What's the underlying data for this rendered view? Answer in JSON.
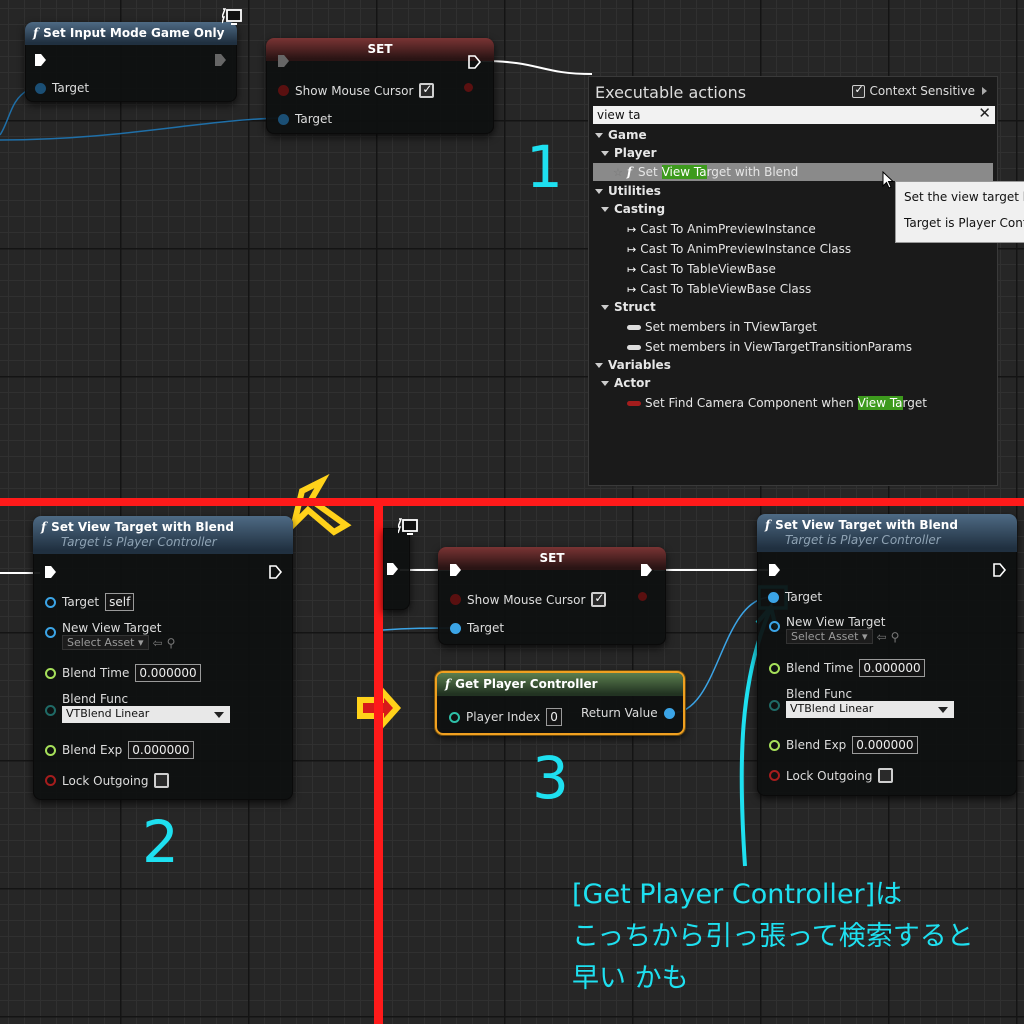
{
  "node_set_input_mode": {
    "title": "Set Input Mode Game Only",
    "target_label": "Target"
  },
  "node_set_top": {
    "title": "SET",
    "show_mouse_cursor": "Show Mouse Cursor",
    "target_label": "Target",
    "show_mouse_cursor_checked": true
  },
  "menu": {
    "title": "Executable actions",
    "context_sensitive": "Context Sensitive",
    "context_sensitive_checked": true,
    "search_value": "view ta",
    "clear_icon": "close-icon",
    "categories": {
      "game": "Game",
      "player": "Player",
      "utilities": "Utilities",
      "casting": "Casting",
      "struct": "Struct",
      "variables": "Variables",
      "actor": "Actor"
    },
    "items": {
      "svtwb_pre": "Set ",
      "svtwb_hl": "View Ta",
      "svtwb_post": "rget with Blend",
      "cast1": "Cast To AnimPreviewInstance",
      "cast2": "Cast To AnimPreviewInstance Class",
      "cast3": "Cast To TableViewBase",
      "cast4": "Cast To TableViewBase Class",
      "struct1": "Set members in TViewTarget",
      "struct2": "Set members in ViewTargetTransitionParams",
      "var_pre": "Set Find Camera Component when ",
      "var_hl": "View Ta",
      "var_post": "rget"
    }
  },
  "tooltip": {
    "line1": "Set the view target ble",
    "line2": "Target is Player Contro"
  },
  "node_svtwb_left": {
    "title": "Set View Target with Blend",
    "subtitle": "Target is Player Controller",
    "target_label": "Target",
    "target_value": "self",
    "new_view_target": "New View Target",
    "select_asset": "Select Asset",
    "blend_time": "Blend Time",
    "blend_time_value": "0.000000",
    "blend_func": "Blend Func",
    "blend_func_value": "VTBlend Linear",
    "blend_exp": "Blend Exp",
    "blend_exp_value": "0.000000",
    "lock_outgoing": "Lock Outgoing"
  },
  "node_set_bottom": {
    "title": "SET",
    "show_mouse_cursor": "Show Mouse Cursor",
    "target_label": "Target",
    "show_mouse_cursor_checked": true
  },
  "node_get_player_controller": {
    "title": "Get Player Controller",
    "player_index": "Player Index",
    "player_index_value": "0",
    "return_value": "Return Value"
  },
  "node_svtwb_right": {
    "title": "Set View Target with Blend",
    "subtitle": "Target is Player Controller",
    "target_label": "Target",
    "new_view_target": "New View Target",
    "select_asset": "Select Asset",
    "blend_time": "Blend Time",
    "blend_time_value": "0.000000",
    "blend_func": "Blend Func",
    "blend_func_value": "VTBlend Linear",
    "blend_exp": "Blend Exp",
    "blend_exp_value": "0.000000",
    "lock_outgoing": "Lock Outgoing"
  },
  "annotations": {
    "num1": "1",
    "num2": "2",
    "num3": "3",
    "note_line1": "[Get Player Controller]は",
    "note_line2": "こっちから引っ張って検索すると",
    "note_line3": "早い かも",
    "accent_color": "#1ee0f0",
    "divider_color": "#ff1a1a",
    "arrow_color": "#ffd21a"
  }
}
